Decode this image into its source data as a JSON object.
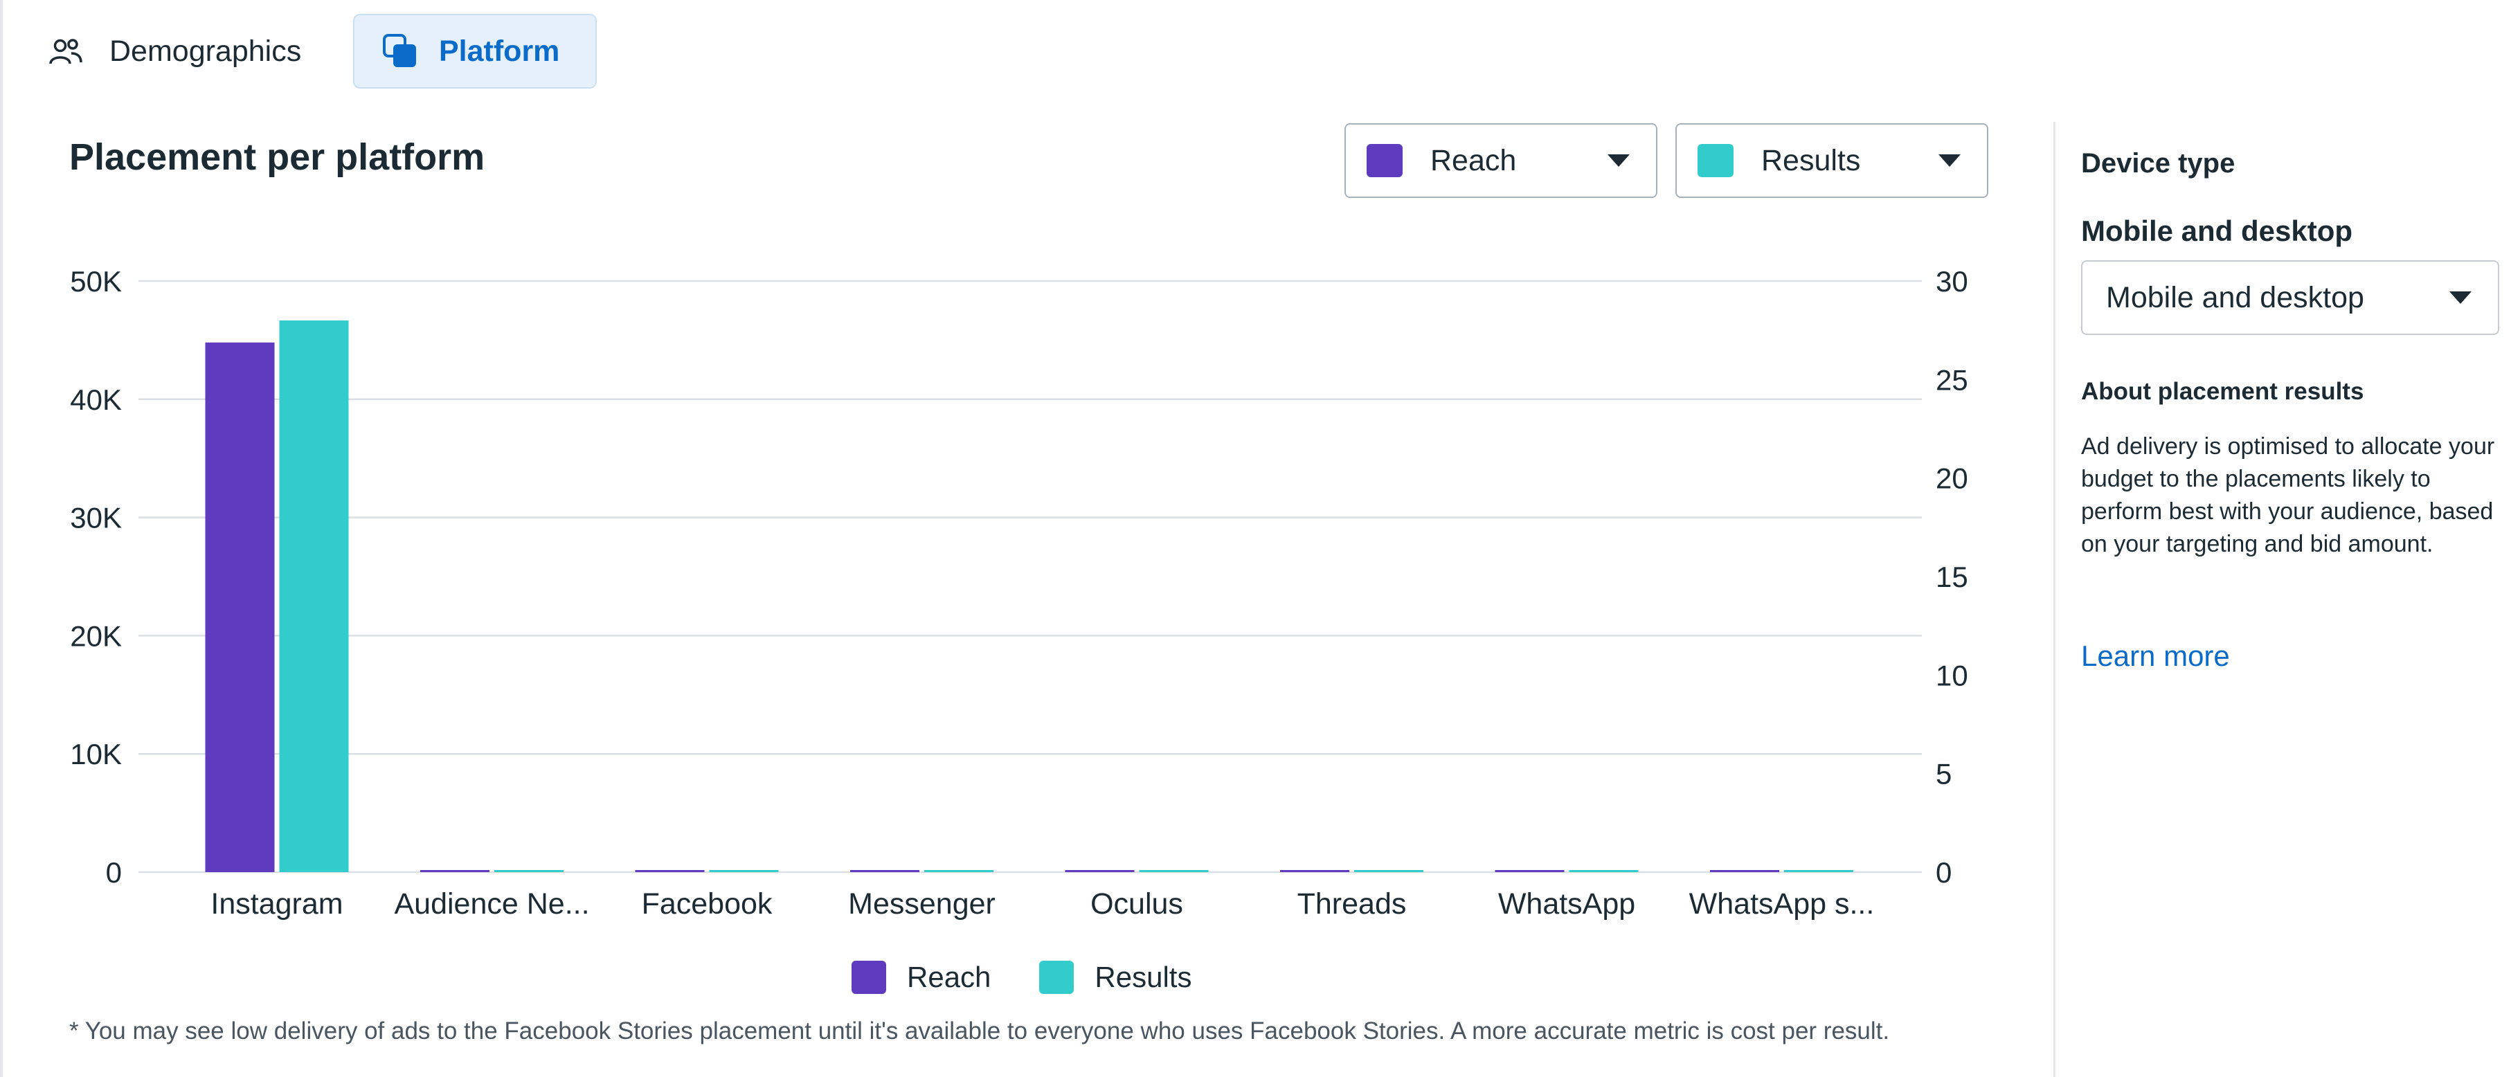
{
  "tabs": [
    {
      "label": "Demographics",
      "icon": "people-icon",
      "selected": false
    },
    {
      "label": "Platform",
      "icon": "platform-icon",
      "selected": true
    }
  ],
  "chart_header": {
    "title": "Placement per platform"
  },
  "metric_selectors": [
    {
      "label": "Reach",
      "color": "#5e3bbf"
    },
    {
      "label": "Results",
      "color": "#33cccc"
    }
  ],
  "chart_data": {
    "type": "bar",
    "title": "Placement per platform",
    "categories": [
      "Instagram",
      "Audience Ne...",
      "Facebook",
      "Messenger",
      "Oculus",
      "Threads",
      "WhatsApp",
      "WhatsApp s..."
    ],
    "series": [
      {
        "name": "Reach",
        "axis": "left",
        "color": "#5e3bbf",
        "values": [
          44800,
          0,
          0,
          0,
          0,
          0,
          0,
          0
        ]
      },
      {
        "name": "Results",
        "axis": "right",
        "color": "#33cccc",
        "values": [
          28,
          0,
          0,
          0,
          0,
          0,
          0,
          0
        ]
      }
    ],
    "y_left": {
      "ylim": [
        0,
        50000
      ],
      "tick_labels": [
        "0",
        "10K",
        "20K",
        "30K",
        "40K",
        "50K"
      ]
    },
    "y_right": {
      "ylim": [
        0,
        30
      ],
      "tick_labels": [
        "0",
        "5",
        "10",
        "15",
        "20",
        "25",
        "30"
      ]
    },
    "xlabel": "",
    "ylabel": "",
    "grid": true,
    "legend": "bottom-center"
  },
  "legend": [
    {
      "label": "Reach",
      "color": "#5e3bbf"
    },
    {
      "label": "Results",
      "color": "#33cccc"
    }
  ],
  "footnote": "* You may see low delivery of ads to the Facebook Stories placement until it's available to everyone who uses Facebook Stories. A more accurate metric is cost per result.",
  "side_panel": {
    "heading": "Device type",
    "subheading": "Mobile and desktop",
    "device_select_value": "Mobile and desktop",
    "about_heading": "About placement results",
    "about_body": "Ad delivery is optimised to allocate your budget to the placements likely to perform best with your audience, based on your targeting and bid amount.",
    "learn_more": "Learn more"
  }
}
